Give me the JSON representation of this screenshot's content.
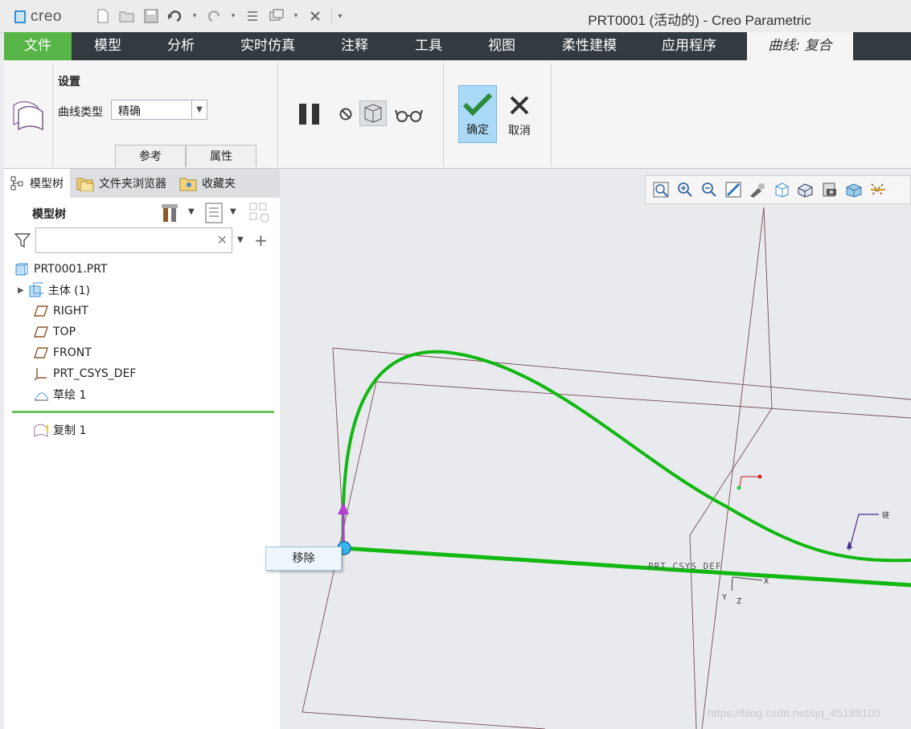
{
  "app": {
    "logo_text": "creo",
    "window_title": "PRT0001 (活动的) - Creo Parametric"
  },
  "ribbon_tabs": [
    {
      "label": "文件"
    },
    {
      "label": "模型"
    },
    {
      "label": "分析"
    },
    {
      "label": "实时仿真"
    },
    {
      "label": "注释"
    },
    {
      "label": "工具"
    },
    {
      "label": "视图"
    },
    {
      "label": "柔性建模"
    },
    {
      "label": "应用程序"
    },
    {
      "label": "曲线: 复合"
    }
  ],
  "ribbon": {
    "settings_label": "设置",
    "curve_type_label": "曲线类型",
    "curve_type_value": "精确",
    "subtabs": [
      "参考",
      "属性"
    ],
    "ok_label": "确定",
    "cancel_label": "取消"
  },
  "nav_tabs": [
    "模型树",
    "文件夹浏览器",
    "收藏夹"
  ],
  "model_tree": {
    "header": "模型树",
    "search_placeholder": "",
    "items": [
      {
        "label": "PRT0001.PRT",
        "icon": "part-icon"
      },
      {
        "label": "主体 (1)",
        "icon": "body-icon"
      },
      {
        "label": "RIGHT",
        "icon": "datum-plane-icon"
      },
      {
        "label": "TOP",
        "icon": "datum-plane-icon"
      },
      {
        "label": "FRONT",
        "icon": "datum-plane-icon"
      },
      {
        "label": "PRT_CSYS_DEF",
        "icon": "csys-icon"
      },
      {
        "label": "草绘 1",
        "icon": "sketch-icon"
      },
      {
        "label": "复制 1",
        "icon": "copy-curve-icon"
      }
    ]
  },
  "graphics": {
    "popup_label": "移除",
    "csys_label": "PRT_CSYS_DEF",
    "axis_x": "X",
    "axis_y": "Y",
    "axis_z": "Z",
    "leader_label": "链"
  },
  "colors": {
    "accent_green": "#58b547",
    "curve_green": "#11b811",
    "ribbon_dark": "#333a40",
    "selection_blue": "#aadaf7"
  },
  "watermark": "https://blog.csdn.net/qq_45189100"
}
